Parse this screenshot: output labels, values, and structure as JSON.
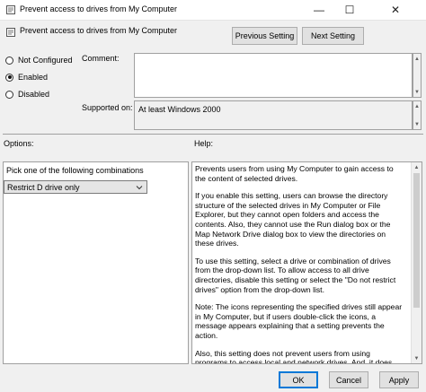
{
  "window": {
    "title": "Prevent access to drives from My Computer",
    "minimize_glyph": "—",
    "maximize_glyph": "☐",
    "close_glyph": "✕"
  },
  "header": {
    "setting_name": "Prevent access to drives from My Computer",
    "previous_label": "Previous Setting",
    "next_label": "Next Setting"
  },
  "state": {
    "options": [
      {
        "label": "Not Configured",
        "checked": false
      },
      {
        "label": "Enabled",
        "checked": true
      },
      {
        "label": "Disabled",
        "checked": false
      }
    ]
  },
  "comment": {
    "label": "Comment:",
    "value": ""
  },
  "supported": {
    "label": "Supported on:",
    "value": "At least Windows 2000"
  },
  "options_panel": {
    "label": "Options:",
    "combo_label": "Pick one of the following combinations",
    "selected": "Restrict D drive only"
  },
  "help": {
    "label": "Help:",
    "paragraphs": [
      "Prevents users from using My Computer to gain access to the content of selected drives.",
      "If you enable this setting, users can browse the directory structure of the selected drives in My Computer or File Explorer, but they cannot open folders and access the contents. Also, they cannot use the Run dialog box or the Map Network Drive dialog box to view the directories on these drives.",
      "To use this setting, select a drive or combination of drives from the drop-down list. To allow access to all drive directories, disable this setting or select the \"Do not restrict drives\" option from the drop-down list.",
      "Note: The icons representing the specified drives still appear in My Computer, but if users double-click the icons, a message appears explaining that a setting prevents the action.",
      "Also, this setting does not prevent users from using programs to access local and network drives. And, it does not prevent them from using the Disk Management snap-in to view and change"
    ]
  },
  "footer": {
    "ok_label": "OK",
    "cancel_label": "Cancel",
    "apply_label": "Apply"
  }
}
